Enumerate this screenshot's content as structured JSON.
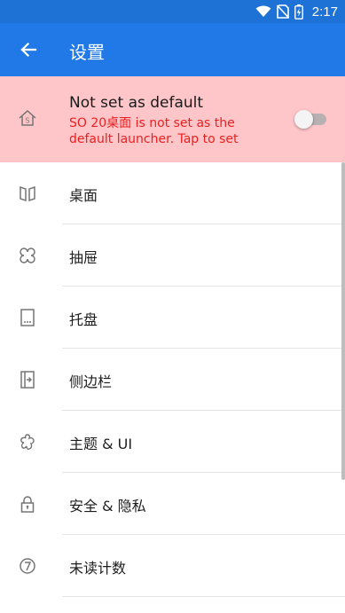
{
  "status_bar": {
    "time": "2:17",
    "icons": [
      "wifi-icon",
      "no-sim-icon",
      "battery-charging-icon"
    ]
  },
  "app_bar": {
    "back_icon": "arrow-left-icon",
    "title": "设置"
  },
  "banner": {
    "icon": "home-s-icon",
    "title": "Not set as default",
    "description": "SO 20桌面 is not set as the default launcher. Tap to set",
    "toggle_on": false,
    "background": "#ffc6ca",
    "description_color": "#e82020"
  },
  "menu": {
    "items": [
      {
        "label": "桌面",
        "icon": "desktop-panels-icon"
      },
      {
        "label": "抽屉",
        "icon": "drawer-clover-icon"
      },
      {
        "label": "托盘",
        "icon": "tray-icon"
      },
      {
        "label": "侧边栏",
        "icon": "sidebar-icon"
      },
      {
        "label": "主题 & UI",
        "icon": "theme-icon"
      },
      {
        "label": "安全 & 隐私",
        "icon": "lock-icon"
      },
      {
        "label": "未读计数",
        "icon": "badge-count-icon"
      }
    ]
  },
  "colors": {
    "status_bar": "#1e72d6",
    "app_bar": "#2079e6",
    "icon_gray": "#757575"
  }
}
